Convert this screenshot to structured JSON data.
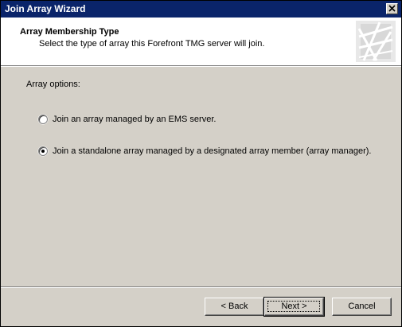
{
  "window": {
    "title": "Join Array Wizard",
    "close_icon": "close-icon"
  },
  "header": {
    "title": "Array Membership Type",
    "subtitle": "Select the type of array this Forefront TMG server will join.",
    "logo_icon": "wizard-logo-icon"
  },
  "content": {
    "section_label": "Array options:",
    "options": [
      {
        "label": "Join an array managed by an EMS server.",
        "selected": false
      },
      {
        "label": "Join a standalone array managed by a designated array member (array manager).",
        "selected": true
      }
    ]
  },
  "footer": {
    "back_label": "< Back",
    "next_label": "Next >",
    "cancel_label": "Cancel"
  },
  "colors": {
    "titlebar": "#0a246a",
    "dialog_bg": "#d4d0c8",
    "header_bg": "#ffffff"
  }
}
